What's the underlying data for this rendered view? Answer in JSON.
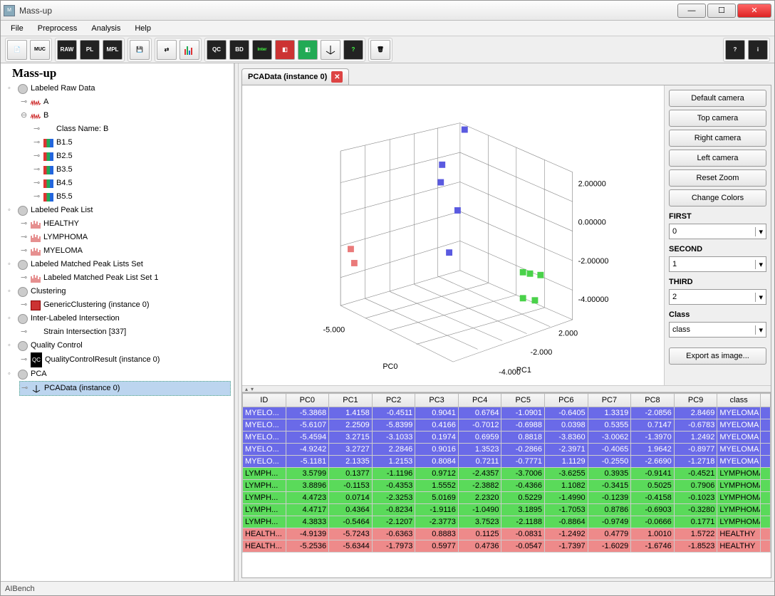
{
  "window": {
    "title": "Mass-up"
  },
  "menu": [
    "File",
    "Preprocess",
    "Analysis",
    "Help"
  ],
  "toolbar": {
    "groups": [
      [
        "doc-icon",
        "muc-icon"
      ],
      [
        "RAW",
        "PL",
        "MPL"
      ],
      [
        "save-icon"
      ],
      [
        "transfer-icon",
        "bars-icon"
      ],
      [
        "QC",
        "BD",
        "inter-icon",
        "cluster2-icon",
        "cluster3-icon",
        "pca-icon",
        "help-green-icon"
      ],
      [
        "trash-icon"
      ]
    ],
    "right": [
      "help-icon",
      "info-icon"
    ]
  },
  "tree": {
    "title": "Mass-up",
    "items": [
      {
        "label": "Labeled Raw Data",
        "children": [
          {
            "label": "A",
            "icon": "wave"
          },
          {
            "label": "B",
            "icon": "wave",
            "children": [
              {
                "label": "Class Name: B"
              },
              {
                "label": "B1.5",
                "icon": "bars"
              },
              {
                "label": "B2.5",
                "icon": "bars"
              },
              {
                "label": "B3.5",
                "icon": "bars"
              },
              {
                "label": "B4.5",
                "icon": "bars"
              },
              {
                "label": "B5.5",
                "icon": "bars"
              }
            ]
          }
        ]
      },
      {
        "label": "Labeled Peak List",
        "children": [
          {
            "label": "HEALTHY",
            "icon": "peaks"
          },
          {
            "label": "LYMPHOMA",
            "icon": "peaks"
          },
          {
            "label": "MYELOMA",
            "icon": "peaks"
          }
        ]
      },
      {
        "label": "Labeled Matched Peak Lists Set",
        "children": [
          {
            "label": "Labeled Matched Peak List Set 1",
            "icon": "peaks"
          }
        ]
      },
      {
        "label": "Clustering",
        "children": [
          {
            "label": "GenericClustering (instance 0)",
            "icon": "cluster"
          }
        ]
      },
      {
        "label": "Inter-Labeled Intersection",
        "children": [
          {
            "label": "Strain Intersection [337]"
          }
        ]
      },
      {
        "label": "Quality Control",
        "children": [
          {
            "label": "QualityControlResult (instance 0)",
            "icon": "qc"
          }
        ]
      },
      {
        "label": "PCA",
        "children": [
          {
            "label": "PCAData (instance 0)",
            "icon": "pca",
            "selected": true
          }
        ]
      }
    ]
  },
  "tab": {
    "label": "PCAData (instance 0)"
  },
  "right_panel": {
    "buttons": [
      "Default camera",
      "Top camera",
      "Right camera",
      "Left camera",
      "Reset Zoom",
      "Change Colors"
    ],
    "first_label": "FIRST",
    "first_value": "0",
    "second_label": "SECOND",
    "second_value": "1",
    "third_label": "THIRD",
    "third_value": "2",
    "class_label": "Class",
    "class_value": "class",
    "export": "Export as image..."
  },
  "plot": {
    "axes": {
      "x": "PC0",
      "y": "PC1",
      "z": ""
    },
    "xticks": [
      "-5.000"
    ],
    "yticks": [
      "2.000",
      "-2.000",
      "-4.000"
    ],
    "zticks": [
      "2.00000",
      "0.00000",
      "-2.00000",
      "-4.00000"
    ]
  },
  "table": {
    "columns": [
      "ID",
      "PC0",
      "PC1",
      "PC2",
      "PC3",
      "PC4",
      "PC5",
      "PC6",
      "PC7",
      "PC8",
      "PC9",
      "class"
    ],
    "rows": [
      {
        "class": "MYELOMA",
        "id": "MYELO...",
        "v": [
          -5.3868,
          1.4158,
          -0.4511,
          0.9041,
          0.6764,
          -1.0901,
          -0.6405,
          1.3319,
          -2.0856,
          2.8469
        ]
      },
      {
        "class": "MYELOMA",
        "id": "MYELO...",
        "v": [
          -5.6107,
          2.2509,
          -5.8399,
          0.4166,
          -0.7012,
          -0.6988,
          0.0398,
          0.5355,
          0.7147,
          -0.6783
        ]
      },
      {
        "class": "MYELOMA",
        "id": "MYELO...",
        "v": [
          -5.4594,
          3.2715,
          -3.1033,
          0.1974,
          0.6959,
          0.8818,
          -3.836,
          -3.0062,
          -1.397,
          1.2492
        ]
      },
      {
        "class": "MYELOMA",
        "id": "MYELO...",
        "v": [
          -4.9242,
          3.2727,
          2.2846,
          0.9016,
          1.3523,
          -0.2866,
          -2.3971,
          -0.4065,
          1.9642,
          -0.8977
        ]
      },
      {
        "class": "MYELOMA",
        "id": "MYELO...",
        "v": [
          -5.1181,
          2.1335,
          1.2153,
          0.8084,
          0.7211,
          -0.7771,
          1.1129,
          -0.255,
          -2.669,
          -1.2718
        ]
      },
      {
        "class": "LYMPHOMA",
        "id": "LYMPH...",
        "v": [
          3.5799,
          0.1377,
          -1.1196,
          0.9712,
          -2.4357,
          -3.7006,
          -3.6255,
          0.3935,
          -0.9141,
          -0.4521
        ]
      },
      {
        "class": "LYMPHOMA",
        "id": "LYMPH...",
        "v": [
          3.8896,
          -0.1153,
          -0.4353,
          1.5552,
          -2.3882,
          -0.4366,
          1.1082,
          -0.3415,
          0.5025,
          0.7906
        ]
      },
      {
        "class": "LYMPHOMA",
        "id": "LYMPH...",
        "v": [
          4.4723,
          0.0714,
          -2.3253,
          5.0169,
          2.232,
          0.5229,
          -1.499,
          -0.1239,
          -0.4158,
          -0.1023
        ]
      },
      {
        "class": "LYMPHOMA",
        "id": "LYMPH...",
        "v": [
          4.4717,
          0.4364,
          -0.8234,
          -1.9116,
          -1.049,
          3.1895,
          -1.7053,
          0.8786,
          -0.6903,
          -0.328
        ]
      },
      {
        "class": "LYMPHOMA",
        "id": "LYMPH...",
        "v": [
          4.3833,
          -0.5464,
          -2.1207,
          -2.3773,
          3.7523,
          -2.1188,
          -0.8864,
          -0.9749,
          -0.0666,
          0.1771
        ]
      },
      {
        "class": "HEALTHY",
        "id": "HEALTH...",
        "v": [
          -4.9139,
          -5.7243,
          -0.6363,
          0.8883,
          0.1125,
          -0.0831,
          -1.2492,
          0.4779,
          1.001,
          1.5722
        ]
      },
      {
        "class": "HEALTHY",
        "id": "HEALTH...",
        "v": [
          -5.2536,
          -5.6344,
          -1.7973,
          0.5977,
          0.4736,
          -0.0547,
          -1.7397,
          -1.6029,
          -1.6746,
          -1.8523
        ]
      }
    ]
  },
  "status": "AIBench",
  "chart_data": {
    "type": "scatter",
    "title": "",
    "axes": {
      "x": "PC0",
      "y": "PC1",
      "z": ""
    },
    "xlim": [
      -5,
      2
    ],
    "ylim": [
      -4,
      2
    ],
    "zlim": [
      -4,
      2
    ],
    "series": [
      {
        "name": "MYELOMA",
        "color": "#5a5ae0",
        "points": [
          [
            -5.39,
            1.42
          ],
          [
            -5.61,
            2.25
          ],
          [
            -5.46,
            3.27
          ],
          [
            -4.92,
            3.27
          ],
          [
            -5.12,
            2.13
          ]
        ]
      },
      {
        "name": "LYMPHOMA",
        "color": "#4ad24a",
        "points": [
          [
            3.58,
            0.14
          ],
          [
            3.89,
            -0.12
          ],
          [
            4.47,
            0.07
          ],
          [
            4.47,
            0.44
          ],
          [
            4.38,
            -0.55
          ]
        ]
      },
      {
        "name": "HEALTHY",
        "color": "#ea7a7a",
        "points": [
          [
            -4.91,
            -5.72
          ],
          [
            -5.25,
            -5.63
          ]
        ]
      }
    ]
  }
}
